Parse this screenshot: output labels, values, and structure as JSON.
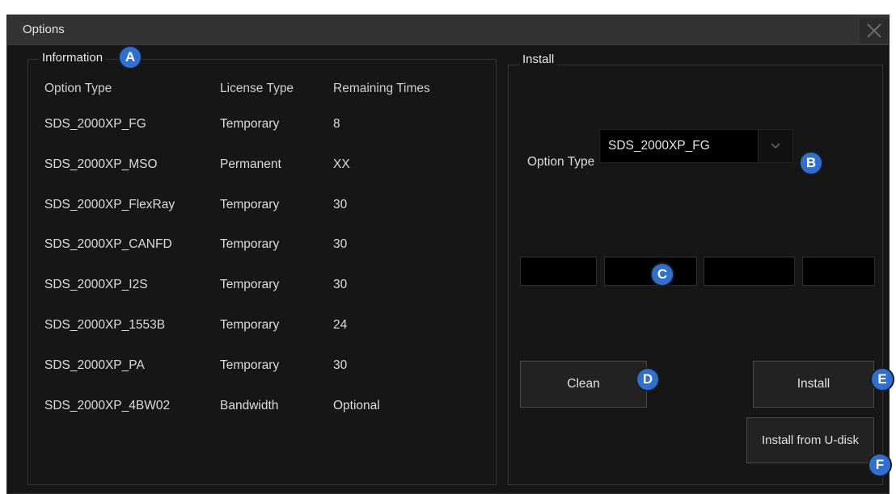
{
  "window": {
    "title": "Options"
  },
  "information": {
    "label": "Information",
    "badge": "A",
    "headers": [
      "Option Type",
      "License Type",
      "Remaining Times"
    ],
    "rows": [
      [
        "SDS_2000XP_FG",
        "Temporary",
        "8"
      ],
      [
        "SDS_2000XP_MSO",
        "Permanent",
        "XX"
      ],
      [
        "SDS_2000XP_FlexRay",
        "Temporary",
        "30"
      ],
      [
        "SDS_2000XP_CANFD",
        "Temporary",
        "30"
      ],
      [
        "SDS_2000XP_I2S",
        "Temporary",
        "30"
      ],
      [
        "SDS_2000XP_1553B",
        "Temporary",
        "24"
      ],
      [
        "SDS_2000XP_PA",
        "Temporary",
        "30"
      ],
      [
        "SDS_2000XP_4BW02",
        "Bandwidth",
        "Optional"
      ]
    ]
  },
  "install": {
    "label": "Install",
    "option_type_label": "Option Type",
    "option_type_value": "SDS_2000XP_FG",
    "badge_select": "B",
    "badge_code": "C",
    "clean_label": "Clean",
    "badge_clean": "D",
    "install_label": "Install",
    "badge_install": "E",
    "install_udisk_label": "Install from U-disk",
    "badge_udisk": "F"
  },
  "icons": {
    "close": "close-icon",
    "dropdown": "chevron-down-icon"
  },
  "colors": {
    "background": "#161616",
    "titlebar": "#333333",
    "badge": "#2f6fd1",
    "input": "#000000"
  }
}
